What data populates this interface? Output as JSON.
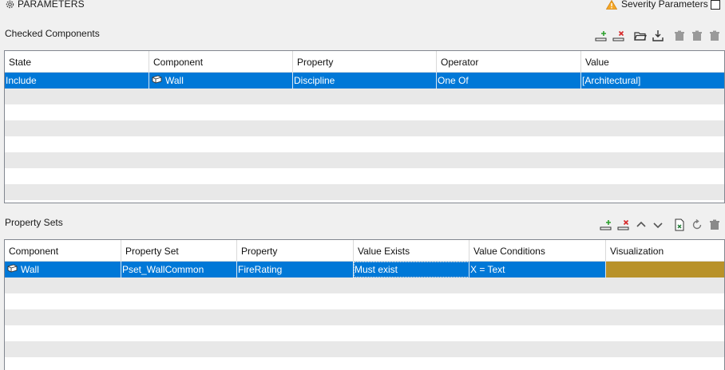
{
  "header": {
    "title": "PARAMETERS",
    "severity_label": "Severity Parameters"
  },
  "checked_components": {
    "label": "Checked Components",
    "columns": [
      "State",
      "Component",
      "Property",
      "Operator",
      "Value"
    ],
    "rows": [
      {
        "state": "Include",
        "component": "Wall",
        "property": "Discipline",
        "operator": "One Of",
        "value": "[Architectural]"
      }
    ],
    "toolbar": [
      "add-row-icon",
      "remove-row-icon",
      "open-folder-icon",
      "download-icon",
      "trash-icon",
      "trash-icon",
      "trash-icon"
    ]
  },
  "property_sets": {
    "label": "Property Sets",
    "columns": [
      "Component",
      "Property Set",
      "Property",
      "Value Exists",
      "Value Conditions",
      "Visualization"
    ],
    "rows": [
      {
        "component": "Wall",
        "property_set": "Pset_WallCommon",
        "property": "FireRating",
        "value_exists": "Must exist",
        "value_conditions": "X = Text",
        "visualization_color": "#b8922a"
      }
    ],
    "toolbar": [
      "add-row-icon",
      "remove-row-icon",
      "move-up-icon",
      "move-down-icon",
      "export-excel-icon",
      "refresh-icon",
      "delete-icon"
    ]
  },
  "colors": {
    "selection": "#0078d7",
    "alt_row": "#e8e8e8",
    "warning": "#f5a623",
    "visualization": "#b8922a"
  }
}
